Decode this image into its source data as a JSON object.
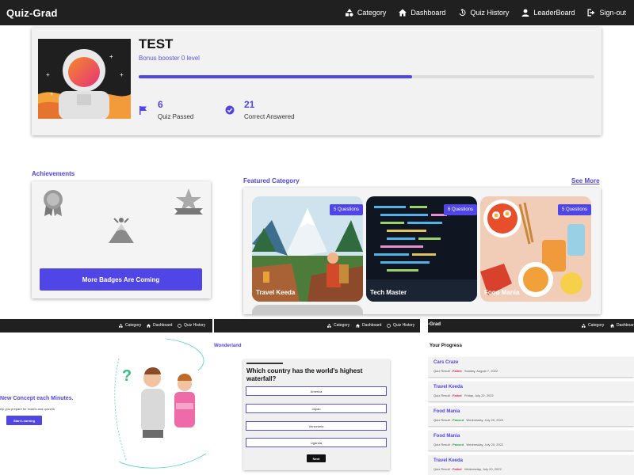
{
  "app": {
    "brand": "Quiz-Grad"
  },
  "nav": [
    {
      "label": "Category",
      "icon": "category-icon"
    },
    {
      "label": "Dashboard",
      "icon": "home-icon"
    },
    {
      "label": "Quiz History",
      "icon": "history-icon"
    },
    {
      "label": "LeaderBoard",
      "icon": "user-icon"
    },
    {
      "label": "Sign-out",
      "icon": "signout-icon"
    }
  ],
  "profile": {
    "name": "TEST",
    "level": "Bonus booster 0 level",
    "progress_percent": 60,
    "quiz_passed": {
      "value": "6",
      "label": "Quiz Passed"
    },
    "correct_answered": {
      "value": "21",
      "label": "Correct Answered"
    }
  },
  "achievements": {
    "title": "Achievements",
    "button": "More Badges Are Coming"
  },
  "featured": {
    "title": "Featured Category",
    "see_more": "See More",
    "categories": [
      {
        "name": "Travel Keeda",
        "questions": "5 Questions"
      },
      {
        "name": "Tech Master",
        "questions": "6 Questions"
      },
      {
        "name": "Food Mania",
        "questions": "5 Questions"
      }
    ]
  },
  "thumb1": {
    "nav": [
      "Category",
      "Dashboard",
      "Quiz History"
    ],
    "headline": "New Concept each Minutes.",
    "sub": "elp you prepare for exams and quizzes",
    "button": "Start Learning"
  },
  "thumb2": {
    "nav": [
      "Category",
      "Dashboard",
      "Quiz History"
    ],
    "heading": "Wonderland",
    "question": "Which country has the world's highest waterfall?",
    "options": [
      "America",
      "Japan",
      "Venezuela",
      "Uganda"
    ],
    "next": "Next"
  },
  "thumb3": {
    "brand_partial": "-Grad",
    "nav": [
      "Category",
      "Dashboar"
    ],
    "title": "Your Progress",
    "items": [
      {
        "title": "Cars Craze",
        "prefix": "Quiz Result :",
        "result": "Failed",
        "date": "Sunday, August 7, 2022"
      },
      {
        "title": "Travel Keeda",
        "prefix": "Quiz Result :",
        "result": "Failed",
        "date": "Friday, July 22, 2022"
      },
      {
        "title": "Food Mania",
        "prefix": "Quiz Result :",
        "result": "Passed",
        "date": "Wednesday, July 20, 2022"
      },
      {
        "title": "Food Mania",
        "prefix": "Quiz Result :",
        "result": "Passed",
        "date": "Wednesday, July 20, 2022"
      },
      {
        "title": "Travel Keeda",
        "prefix": "Quiz Result :",
        "result": "Failed",
        "date": "Wednesday, July 20, 2022"
      }
    ]
  },
  "colors": {
    "accent": "#4f46e5",
    "nav_bg": "#202020",
    "failed": "#e11d48",
    "passed": "#16a34a"
  }
}
